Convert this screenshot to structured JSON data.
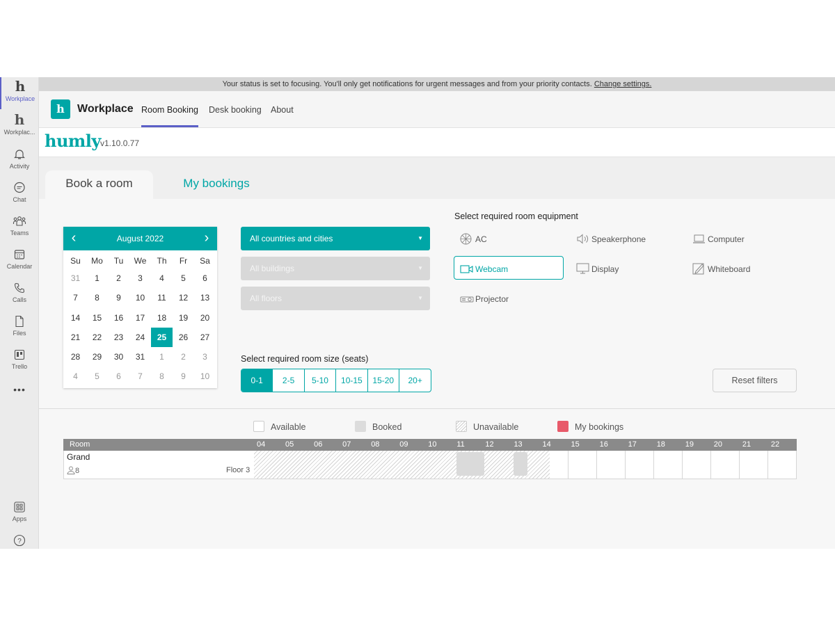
{
  "rail": {
    "items": [
      {
        "label": "Workplace",
        "icon": "humly-app-icon"
      },
      {
        "label": "Workplac...",
        "icon": "humly-app-icon"
      },
      {
        "label": "Activity",
        "icon": "bell-icon"
      },
      {
        "label": "Chat",
        "icon": "chat-icon"
      },
      {
        "label": "Teams",
        "icon": "teams-icon"
      },
      {
        "label": "Calendar",
        "icon": "calendar-icon"
      },
      {
        "label": "Calls",
        "icon": "phone-icon"
      },
      {
        "label": "Files",
        "icon": "file-icon"
      },
      {
        "label": "Trello",
        "icon": "trello-icon"
      },
      {
        "label": "",
        "icon": "more-icon"
      },
      {
        "label": "Apps",
        "icon": "apps-icon"
      },
      {
        "label": "",
        "icon": "help-icon"
      }
    ]
  },
  "statusbar": {
    "text": "Your status is set to focusing. You'll only get notifications for urgent messages and from your priority contacts.",
    "link": "Change settings."
  },
  "header": {
    "logo_letter": "h",
    "title": "Workplace",
    "tabs": [
      "Room Booking",
      "Desk booking",
      "About"
    ],
    "active_tab": "Room Booking"
  },
  "humly": {
    "logo": "humly",
    "version": "v1.10.0.77"
  },
  "content_tabs": {
    "book": "Book a room",
    "my_bookings": "My bookings"
  },
  "calendar": {
    "month_label": "August 2022",
    "weekdays": [
      "Su",
      "Mo",
      "Tu",
      "We",
      "Th",
      "Fr",
      "Sa"
    ],
    "days": [
      [
        "31",
        "1",
        "2",
        "3",
        "4",
        "5",
        "6"
      ],
      [
        "7",
        "8",
        "9",
        "10",
        "11",
        "12",
        "13"
      ],
      [
        "14",
        "15",
        "16",
        "17",
        "18",
        "19",
        "20"
      ],
      [
        "21",
        "22",
        "23",
        "24",
        "25",
        "26",
        "27"
      ],
      [
        "28",
        "29",
        "30",
        "31",
        "1",
        "2",
        "3"
      ],
      [
        "4",
        "5",
        "6",
        "7",
        "8",
        "9",
        "10"
      ]
    ],
    "selected": "25"
  },
  "filters": {
    "location": "All countries and cities",
    "buildings": "All buildings",
    "floors": "All floors"
  },
  "room_size": {
    "label": "Select required room size (seats)",
    "options": [
      "0-1",
      "2-5",
      "5-10",
      "10-15",
      "15-20",
      "20+"
    ],
    "selected": "0-1"
  },
  "equipment": {
    "label": "Select required room equipment",
    "items": [
      {
        "name": "AC",
        "icon": "ac-icon",
        "selected": false
      },
      {
        "name": "Speakerphone",
        "icon": "speaker-icon",
        "selected": false
      },
      {
        "name": "Computer",
        "icon": "laptop-icon",
        "selected": false
      },
      {
        "name": "Webcam",
        "icon": "webcam-icon",
        "selected": true
      },
      {
        "name": "Display",
        "icon": "monitor-icon",
        "selected": false
      },
      {
        "name": "Whiteboard",
        "icon": "whiteboard-icon",
        "selected": false
      },
      {
        "name": "Projector",
        "icon": "projector-icon",
        "selected": false
      }
    ]
  },
  "reset_label": "Reset filters",
  "legend": {
    "available": "Available",
    "booked": "Booked",
    "unavailable": "Unavailable",
    "my_bookings": "My bookings"
  },
  "timeline": {
    "room_header": "Room",
    "hours": [
      "04",
      "05",
      "06",
      "07",
      "08",
      "09",
      "10",
      "11",
      "12",
      "13",
      "14",
      "15",
      "16",
      "17",
      "18",
      "19",
      "20",
      "21",
      "22"
    ],
    "rooms": [
      {
        "name": "Grand",
        "seats": "8",
        "floor": "Floor 3"
      }
    ]
  },
  "colors": {
    "accent": "#00a6a6",
    "teams_purple": "#5b5fc7",
    "my_bookings": "#e85a6a"
  }
}
